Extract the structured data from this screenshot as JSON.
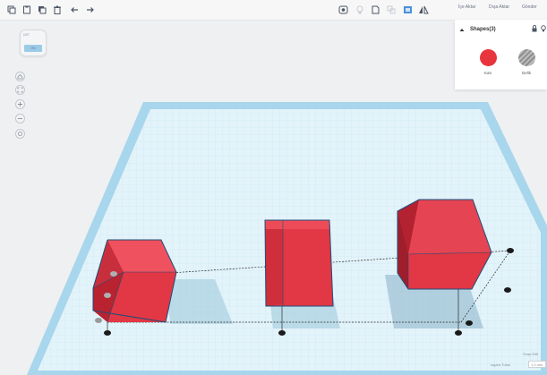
{
  "toolbar": {
    "left_icons": [
      "copy-icon",
      "paste-icon",
      "duplicate-icon",
      "delete-icon",
      "undo-icon",
      "redo-icon"
    ],
    "right_icons": [
      "show-hide-icon",
      "light-bulb-icon",
      "group-icon",
      "ungroup-icon",
      "align-icon",
      "mirror-icon"
    ],
    "import_label": "İçe Aktar",
    "export_label": "Dışa Aktar",
    "send_label": "Gönder"
  },
  "viewcube": {
    "top_label": "ÜST",
    "front_label": "ÖN"
  },
  "nav_buttons": [
    "home-view-icon",
    "fit-view-icon",
    "zoom-in-icon",
    "zoom-out-icon",
    "perspective-icon"
  ],
  "shapes_panel": {
    "title": "Shapes(3)",
    "solid_label": "Katı",
    "hole_label": "Delik",
    "solid_color": "#e8343c"
  },
  "scene": {
    "shapes": [
      {
        "type": "box",
        "color": "#e23744"
      },
      {
        "type": "box",
        "color": "#e23744"
      },
      {
        "type": "box",
        "color": "#e23744"
      }
    ],
    "workplane_color": "#a8d6ec"
  },
  "bottom": {
    "snap_label": "Snap Edit",
    "snap_grid_label": "Izgara Tutun",
    "snap_value": "1.0 mm"
  }
}
